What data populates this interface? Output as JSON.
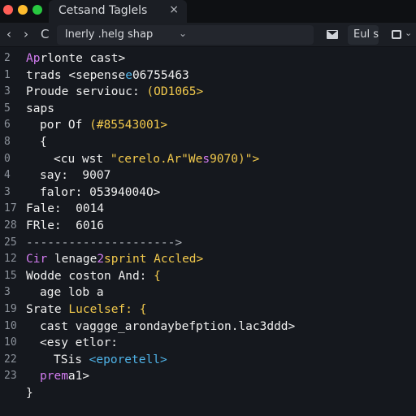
{
  "window": {
    "tab_title": "Cetsand Taglels",
    "tab_close": "×"
  },
  "toolbar": {
    "back": "‹",
    "forward": "›",
    "reload": "C",
    "address_text": "lnerly .helg shap",
    "address_chevron": "⌄",
    "action_button": "Eul s",
    "print_chevron": "⌄"
  },
  "colors": {
    "background": "#15181e",
    "keyword_purple": "#d27cf0",
    "string_yellow": "#f2c94c",
    "tag_cyan": "#4fb3e8"
  },
  "editor": {
    "lines": [
      {
        "num": "2",
        "indent": 0,
        "segments": [
          {
            "text": "Ap",
            "color": "purple"
          },
          {
            "text": "rlonte cast>",
            "color": "white"
          }
        ]
      },
      {
        "num": "1",
        "indent": 0,
        "segments": [
          {
            "text": "trads <sepense",
            "color": "white"
          },
          {
            "text": "e",
            "color": "cyan"
          },
          {
            "text": "06755463",
            "color": "white"
          }
        ]
      },
      {
        "num": "3",
        "indent": 0,
        "segments": [
          {
            "text": "Proude serviouc: ",
            "color": "white"
          },
          {
            "text": "(OD1065>",
            "color": "yellow"
          }
        ]
      },
      {
        "num": "5",
        "indent": 0,
        "segments": [
          {
            "text": "saps",
            "color": "white"
          }
        ]
      },
      {
        "num": "6",
        "indent": 1,
        "segments": [
          {
            "text": "por Of ",
            "color": "white"
          },
          {
            "text": "(#85543001>",
            "color": "yellow"
          }
        ]
      },
      {
        "num": "8",
        "indent": 1,
        "segments": [
          {
            "text": "{",
            "color": "white"
          }
        ]
      },
      {
        "num": "0",
        "indent": 2,
        "segments": [
          {
            "text": "<cu wst ",
            "color": "white"
          },
          {
            "text": "\"cerelo.Ar\"We",
            "color": "yellow"
          },
          {
            "text": "s",
            "color": "purple"
          },
          {
            "text": "9070)\">",
            "color": "yellow"
          }
        ]
      },
      {
        "num": "4",
        "indent": 1,
        "segments": [
          {
            "text": "say:  9007",
            "color": "white"
          }
        ]
      },
      {
        "num": "3",
        "indent": 1,
        "segments": [
          {
            "text": "falor: 05394004O>",
            "color": "white"
          }
        ]
      },
      {
        "num": "17",
        "indent": 0,
        "segments": [
          {
            "text": "Fale:  0014",
            "color": "white"
          }
        ]
      },
      {
        "num": "28",
        "indent": 0,
        "segments": [
          {
            "text": "FRle:  6016",
            "color": "white"
          }
        ]
      },
      {
        "num": "25",
        "indent": 0,
        "segments": [
          {
            "text": "--------------------->",
            "color": "dashed"
          }
        ]
      },
      {
        "num": "12",
        "indent": 0,
        "segments": [
          {
            "text": "Cir ",
            "color": "purple"
          },
          {
            "text": "lenage",
            "color": "white"
          },
          {
            "text": "2",
            "color": "purple"
          },
          {
            "text": "sprint Accled>",
            "color": "yellow"
          }
        ]
      },
      {
        "num": "15",
        "indent": 0,
        "segments": [
          {
            "text": "Wodde coston And: ",
            "color": "white"
          },
          {
            "text": "{",
            "color": "yellow"
          }
        ]
      },
      {
        "num": "3",
        "indent": 1,
        "segments": [
          {
            "text": "age lob a",
            "color": "white"
          }
        ]
      },
      {
        "num": "19",
        "indent": 0,
        "segments": [
          {
            "text": "Srate ",
            "color": "white"
          },
          {
            "text": "Lucelsef: {",
            "color": "yellow"
          }
        ]
      },
      {
        "num": "10",
        "indent": 1,
        "segments": [
          {
            "text": "cast vaggge_arondaybefption.lac3ddd>",
            "color": "white"
          }
        ]
      },
      {
        "num": "10",
        "indent": 1,
        "segments": [
          {
            "text": "<esy etlor:",
            "color": "white"
          }
        ]
      },
      {
        "num": "22",
        "indent": 2,
        "segments": [
          {
            "text": "TSis ",
            "color": "white"
          },
          {
            "text": "<eporetell>",
            "color": "cyan"
          }
        ]
      },
      {
        "num": "23",
        "indent": 1,
        "segments": [
          {
            "text": "prem",
            "color": "purple"
          },
          {
            "text": "a1>",
            "color": "white"
          }
        ]
      },
      {
        "num": "",
        "indent": 0,
        "segments": [
          {
            "text": "}",
            "color": "white"
          }
        ]
      }
    ]
  }
}
